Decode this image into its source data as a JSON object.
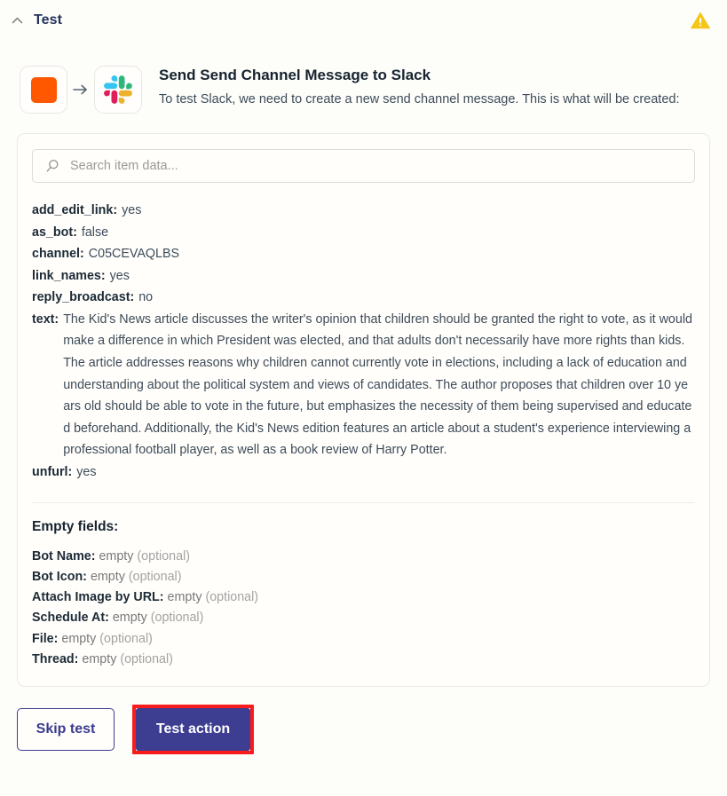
{
  "header": {
    "title": "Test",
    "collapse_icon": "chevron-up-icon",
    "warning_icon": "warning-triangle-icon",
    "warning_color": "#f5c518"
  },
  "intro": {
    "source_icon": "orange-square-app-icon",
    "source_color": "#ff5800",
    "arrow_icon": "arrow-right-icon",
    "target_icon": "slack-logo-icon",
    "title": "Send Send Channel Message to Slack",
    "description": "To test Slack, we need to create a new send channel message. This is what will be created:"
  },
  "search": {
    "icon": "search-icon",
    "placeholder": "Search item data...",
    "value": ""
  },
  "fields": [
    {
      "key": "add_edit_link:",
      "value": "yes"
    },
    {
      "key": "as_bot:",
      "value": "false"
    },
    {
      "key": "channel:",
      "value": "C05CEVAQLBS"
    },
    {
      "key": "link_names:",
      "value": "yes"
    },
    {
      "key": "reply_broadcast:",
      "value": "no"
    },
    {
      "key": "text:",
      "value": "The Kid's News article discusses the writer's opinion that children should be granted the right to vote, as it would make a difference in which President was elected, and that adults don't necessarily have more rights than kids. The article addresses reasons why children cannot currently vote in elections, including a lack of education and understanding about the political system and views of candidates. The author proposes that children over 10 years old should be able to vote in the future, but emphasizes the necessity of them being supervised and educated beforehand. Additionally, the Kid's News edition features an article about a student's experience interviewing a professional football player, as well as a book review of Harry Potter."
    },
    {
      "key": "unfurl:",
      "value": "yes"
    }
  ],
  "empty_section": {
    "title": "Empty fields:",
    "items": [
      {
        "key": "Bot Name:",
        "value": "empty",
        "note": "(optional)"
      },
      {
        "key": "Bot Icon:",
        "value": "empty",
        "note": "(optional)"
      },
      {
        "key": "Attach Image by URL:",
        "value": "empty",
        "note": "(optional)"
      },
      {
        "key": "Schedule At:",
        "value": "empty",
        "note": "(optional)"
      },
      {
        "key": "File:",
        "value": "empty",
        "note": "(optional)"
      },
      {
        "key": "Thread:",
        "value": "empty",
        "note": "(optional)"
      }
    ]
  },
  "footer": {
    "skip_label": "Skip test",
    "test_label": "Test action",
    "test_button_color": "#3d3d92",
    "highlight_color": "#f91c1c"
  }
}
